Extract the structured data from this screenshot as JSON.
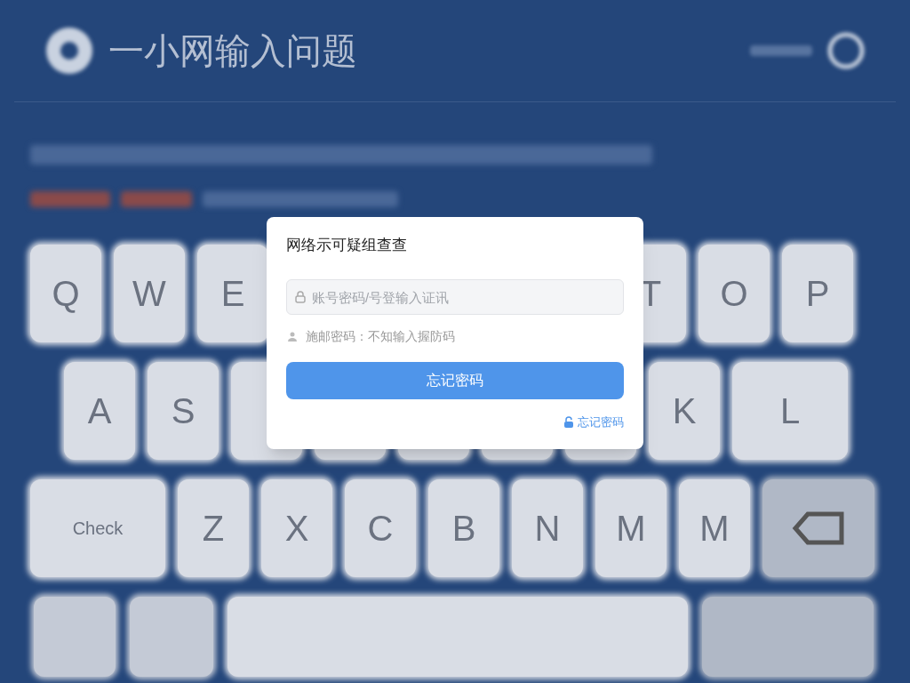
{
  "background": {
    "app_title": "一小网输入问题",
    "keyboard": {
      "rows": [
        {
          "keys": [
            {
              "kind": "letter",
              "label": "Q"
            },
            {
              "kind": "letter",
              "label": "W"
            },
            {
              "kind": "letter",
              "label": "E"
            },
            {
              "kind": "covered"
            },
            {
              "kind": "covered"
            },
            {
              "kind": "covered"
            },
            {
              "kind": "covered"
            },
            {
              "kind": "letter",
              "label": "T"
            },
            {
              "kind": "letter",
              "label": "O"
            },
            {
              "kind": "letter",
              "label": "P"
            }
          ]
        },
        {
          "keys": [
            {
              "kind": "letter",
              "label": "A"
            },
            {
              "kind": "letter",
              "label": "S"
            },
            {
              "kind": "hidden"
            },
            {
              "kind": "hidden"
            },
            {
              "kind": "hidden"
            },
            {
              "kind": "hidden"
            },
            {
              "kind": "hidden"
            },
            {
              "kind": "letter",
              "label": "K"
            },
            {
              "kind": "wide",
              "label": "L"
            }
          ]
        },
        {
          "keys": [
            {
              "kind": "wide",
              "label": "Check"
            },
            {
              "kind": "letter",
              "label": "Z"
            },
            {
              "kind": "letter",
              "label": "X"
            },
            {
              "kind": "letter",
              "label": "C"
            },
            {
              "kind": "letter",
              "label": "B"
            },
            {
              "kind": "letter",
              "label": "N"
            },
            {
              "kind": "letter",
              "label": "M"
            },
            {
              "kind": "letter",
              "label": "M"
            },
            {
              "kind": "backspace"
            }
          ]
        }
      ]
    }
  },
  "dialog": {
    "title": "网络示可疑组查查",
    "field": {
      "placeholder": "账号密码/号登输入证讯"
    },
    "hint": "施邮密码：不知输入握防码",
    "button": "忘记密码",
    "link": "忘记密码"
  }
}
